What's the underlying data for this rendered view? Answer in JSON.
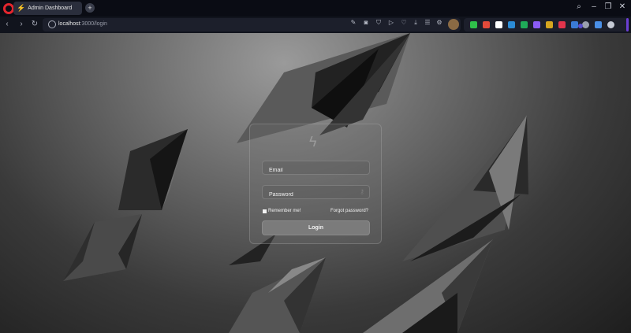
{
  "browser": {
    "tab": {
      "title": "Admin Dashboard"
    },
    "address": {
      "host": "localhost",
      "path": ":3000/login"
    }
  },
  "login": {
    "email_placeholder": "Email",
    "password_placeholder": "Password",
    "remember_label": "Remember me!",
    "forgot_label": "Forgot password?",
    "submit_label": "Login"
  },
  "colors": {
    "opera_red": "#e3262e",
    "card_button": "#7b7b7b",
    "extension_accent": "#6b3fd4"
  }
}
